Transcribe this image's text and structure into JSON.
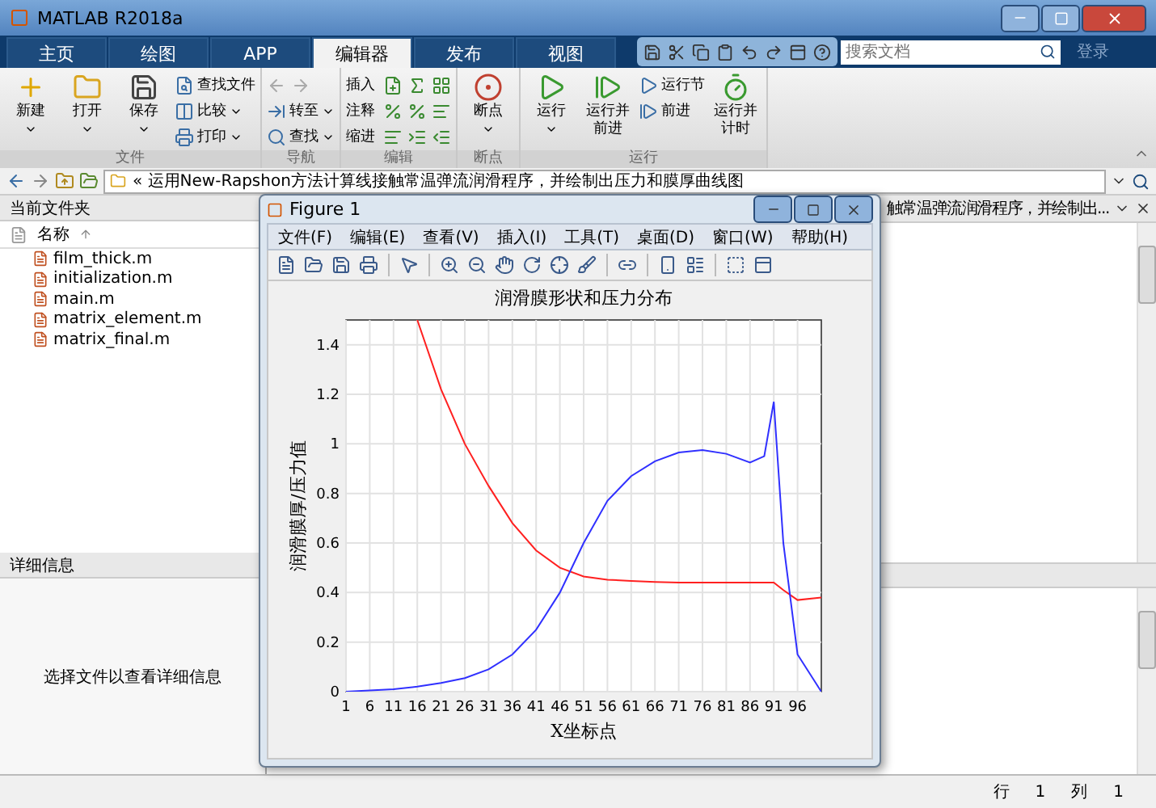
{
  "window": {
    "title": "MATLAB R2018a"
  },
  "tabs": [
    {
      "label": "主页",
      "selected": false
    },
    {
      "label": "绘图",
      "selected": false
    },
    {
      "label": "APP",
      "selected": false
    },
    {
      "label": "编辑器",
      "selected": true
    },
    {
      "label": "发布",
      "selected": false
    },
    {
      "label": "视图",
      "selected": false
    }
  ],
  "search": {
    "placeholder": "搜索文档"
  },
  "login": "登录",
  "toolstrip": {
    "groups": [
      {
        "label": "文件",
        "items": [
          {
            "kind": "large",
            "label": "新建",
            "dropdown": true
          },
          {
            "kind": "large",
            "label": "打开",
            "dropdown": true
          },
          {
            "kind": "large",
            "label": "保存",
            "dropdown": true
          },
          {
            "kind": "stack",
            "rows": [
              {
                "kind": "text",
                "label": "查找文件",
                "dropdown": false
              },
              {
                "kind": "text",
                "label": "比较",
                "dropdown": true
              },
              {
                "kind": "text",
                "label": "打印",
                "dropdown": true
              }
            ]
          }
        ]
      },
      {
        "label": "导航",
        "items": [
          {
            "kind": "stack",
            "rows": [
              {
                "kind": "arrows"
              },
              {
                "kind": "text",
                "label": "转至",
                "dropdown": true
              },
              {
                "kind": "text",
                "label": "查找",
                "dropdown": true
              }
            ]
          }
        ]
      },
      {
        "label": "编辑",
        "items": [
          {
            "kind": "edit",
            "rows": [
              {
                "label": "插入"
              },
              {
                "label": "注释"
              },
              {
                "label": "缩进"
              }
            ]
          }
        ]
      },
      {
        "label": "断点",
        "items": [
          {
            "kind": "large",
            "label": "断点",
            "dropdown": true
          }
        ]
      },
      {
        "label": "运行",
        "items": [
          {
            "kind": "large",
            "label": "运行",
            "dropdown": true
          },
          {
            "kind": "large",
            "label": "运行并前进",
            "dropdown": false
          },
          {
            "kind": "stack",
            "rows": [
              {
                "kind": "text",
                "label": "运行节",
                "dropdown": false
              },
              {
                "kind": "text",
                "label": "前进",
                "dropdown": false
              }
            ]
          },
          {
            "kind": "large",
            "label": "运行并计时",
            "dropdown": false
          }
        ]
      }
    ]
  },
  "address": {
    "path": "« 运用New-Rapshon方法计算线接触常温弹流润滑程序，并绘制出压力和膜厚曲线图"
  },
  "current_folder": {
    "title": "当前文件夹",
    "column": "名称",
    "files": [
      "film_thick.m",
      "initialization.m",
      "main.m",
      "matrix_element.m",
      "matrix_final.m"
    ]
  },
  "details": {
    "title": "详细信息",
    "message": "选择文件以查看详细信息"
  },
  "editor": {
    "tab_title": "触常温弹流润滑程序，并绘制出..."
  },
  "figure": {
    "title": "Figure 1",
    "menus": [
      "文件(F)",
      "编辑(E)",
      "查看(V)",
      "插入(I)",
      "工具(T)",
      "桌面(D)",
      "窗口(W)",
      "帮助(H)"
    ],
    "chart_data": {
      "type": "line",
      "title": "润滑膜形状和压力分布",
      "xlabel": "X坐标点",
      "ylabel": "润滑膜厚/压力值",
      "x": [
        1,
        6,
        11,
        16,
        21,
        26,
        31,
        36,
        41,
        46,
        51,
        56,
        61,
        66,
        71,
        76,
        81,
        86,
        89,
        91,
        93,
        96,
        101
      ],
      "series": [
        {
          "color": "#ff2020",
          "values": [
            null,
            null,
            null,
            1.5,
            1.22,
            1.0,
            0.83,
            0.68,
            0.57,
            0.5,
            0.465,
            0.452,
            0.447,
            0.443,
            0.44,
            0.44,
            0.44,
            0.44,
            0.44,
            0.44,
            0.41,
            0.37,
            0.38
          ]
        },
        {
          "color": "#3030ff",
          "values": [
            0,
            0.005,
            0.01,
            0.02,
            0.035,
            0.055,
            0.09,
            0.15,
            0.25,
            0.4,
            0.6,
            0.77,
            0.87,
            0.93,
            0.965,
            0.975,
            0.96,
            0.925,
            0.95,
            1.17,
            0.6,
            0.15,
            0.0
          ]
        }
      ],
      "xlim": [
        1,
        101
      ],
      "ylim": [
        0,
        1.5
      ],
      "grid": true,
      "xticks": [
        1,
        6,
        11,
        16,
        21,
        26,
        31,
        36,
        41,
        46,
        51,
        56,
        61,
        66,
        71,
        76,
        81,
        86,
        91,
        96
      ],
      "yticks": [
        0,
        0.2,
        0.4,
        0.6,
        0.8,
        1,
        1.2,
        1.4
      ]
    }
  },
  "status": [
    {
      "label": "行",
      "value": "1"
    },
    {
      "label": "列",
      "value": "1"
    }
  ]
}
